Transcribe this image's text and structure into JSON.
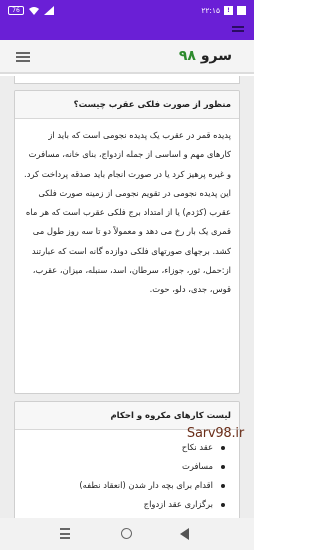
{
  "status": {
    "time": "۲۲:۱۵",
    "battery": "76",
    "notif": "!"
  },
  "header": {
    "logo_text": "سرو",
    "logo_num": "۹۸"
  },
  "card1": {
    "title": "منظور از صورت فلکی عقرب چیست؟",
    "body": "پدیده قمر در عقرب یک پدیده نجومی است که باید از کارهای مهم و اساسی از جمله ازدواج، بنای خانه، مسافرت و غیره پرهیز کرد یا در صورت انجام باید صدقه پرداخت کرد. این پدیده نجومی در تقویم نجومی از زمینه صورت فلکی عقرب (کژدم) یا از امتداد برج فلکی عقرب است که هر ماه قمری یک بار رخ می دهد و معمولاً دو تا سه روز طول می کشد. برجهای صورتهای فلکی دوازده گانه است که عبارتند از:حمل، ثور، جوزاء، سرطان، اسد، سنبله، میزان، عقرب، قوس، جدی، دلو، حوت."
  },
  "card2": {
    "title": "لیست کارهای مکروه و احکام",
    "items": [
      "عقد نکاح",
      "مسافرت",
      "اقدام برای بچه دار شدن (انعقاد نطفه)",
      "برگزاری عقد ازدواج"
    ]
  },
  "watermark": "Sarv98.ir",
  "colors": {
    "statusbar": "#6a1fd6",
    "logo_num": "#2e8b2e"
  }
}
